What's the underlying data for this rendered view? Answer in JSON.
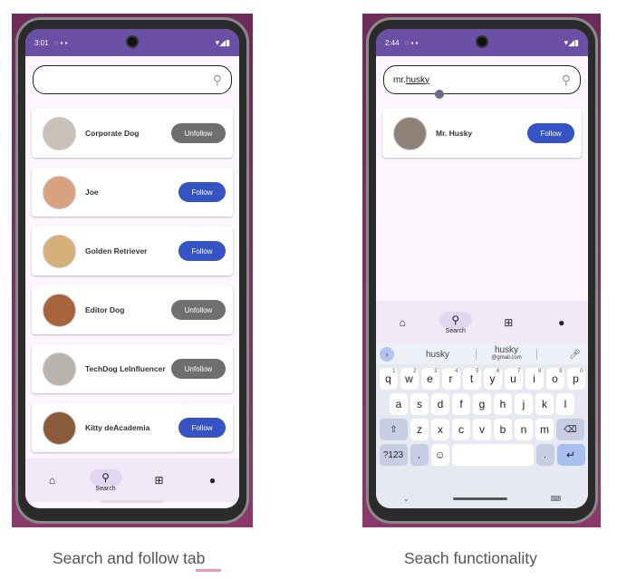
{
  "left_phone": {
    "status": {
      "time": "3:01"
    },
    "search": {
      "value": "",
      "placeholder": ""
    },
    "users": [
      {
        "name": "Corporate Dog",
        "button": "Unfollow",
        "avatar_color": "#c9c0b8"
      },
      {
        "name": "Joe",
        "button": "Follow",
        "avatar_color": "#d9a27f"
      },
      {
        "name": "Golden Retriever",
        "button": "Follow",
        "avatar_color": "#d6b07a"
      },
      {
        "name": "Editor Dog",
        "button": "Unfollow",
        "avatar_color": "#a5643a"
      },
      {
        "name": "TechDog LeInfluencer",
        "button": "Unfollow",
        "avatar_color": "#b9b4ad"
      },
      {
        "name": "Kitty deAcademia",
        "button": "Follow",
        "avatar_color": "#8a5a3a"
      }
    ],
    "nav": {
      "search_label": "Search"
    }
  },
  "right_phone": {
    "status": {
      "time": "2:44"
    },
    "search": {
      "value_prefix": "mr. ",
      "value_word": "husky"
    },
    "results": [
      {
        "name": "Mr. Husky",
        "button": "Follow",
        "avatar_color": "#8e8278"
      }
    ],
    "nav": {
      "search_label": "Search"
    },
    "keyboard": {
      "suggestion_1": "husky",
      "suggestion_2": "husky",
      "suggestion_2_sub": "@gmail.com",
      "row1": [
        "q",
        "w",
        "e",
        "r",
        "t",
        "y",
        "u",
        "i",
        "o",
        "p"
      ],
      "row1_hints": [
        "1",
        "2",
        "3",
        "4",
        "5",
        "6",
        "7",
        "8",
        "9",
        "0"
      ],
      "row2": [
        "a",
        "s",
        "d",
        "f",
        "g",
        "h",
        "j",
        "k",
        "l"
      ],
      "row3": [
        "z",
        "x",
        "c",
        "v",
        "b",
        "n",
        "m"
      ],
      "sym_label": "?123",
      "comma": ",",
      "period": "."
    }
  },
  "captions": {
    "left": "Search and follow tab",
    "right": "Seach functionality"
  },
  "colors": {
    "accent": "#6b4fa5",
    "follow": "#3653c4",
    "unfollow": "#6f6f6f",
    "background": "#fdf6ff"
  }
}
